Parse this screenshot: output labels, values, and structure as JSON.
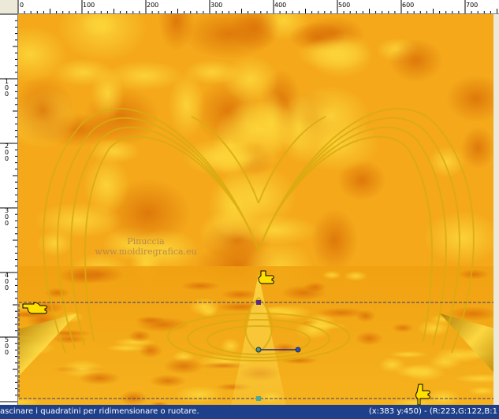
{
  "ruler": {
    "top_labels": [
      "0",
      "100",
      "200",
      "300",
      "400",
      "500",
      "600",
      "700"
    ],
    "left_labels": [
      "1 0 0",
      "2 0 0",
      "3 0 0",
      "4 0 0",
      "5 0 0"
    ]
  },
  "canvas": {
    "watermark_line1": "Pinuccia",
    "watermark_line2": "www.moidiregrafica.eu"
  },
  "status": {
    "hint": "ascinare i quadratini per ridimensionare o ruotare.",
    "readout": "(x:383 y:450) - (R:223,G:122,B:1"
  },
  "colors": {
    "canvas_bg": "#f4a81a",
    "statusbar_bg": "#1e3f8a",
    "heart_gold": "#d4a30a"
  }
}
